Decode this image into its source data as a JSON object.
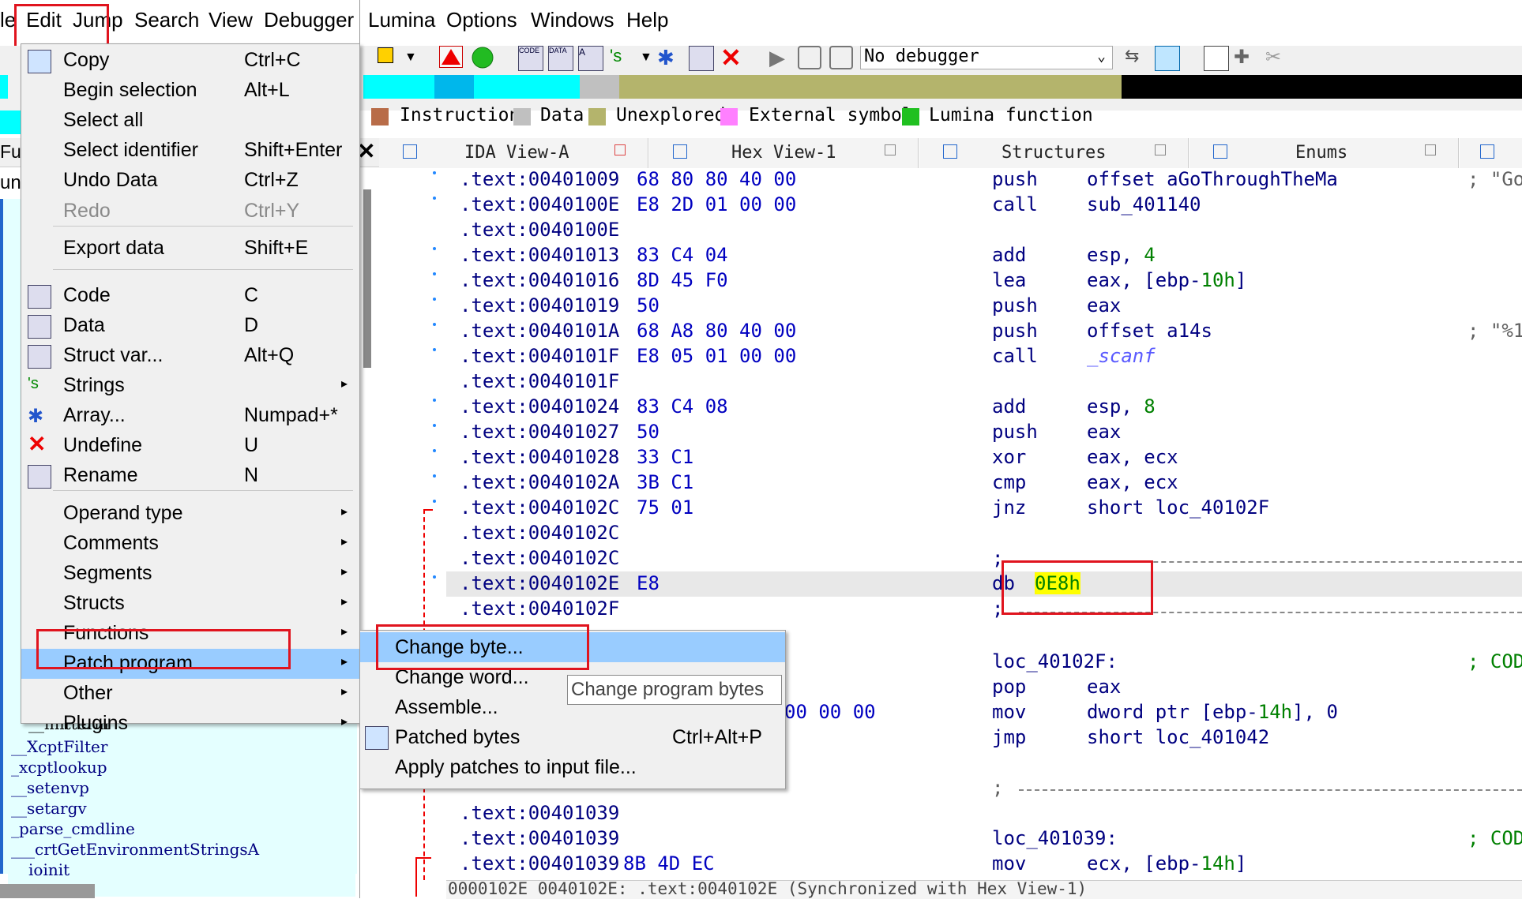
{
  "menubar": {
    "items": [
      "le",
      "Edit",
      "Jump",
      "Search",
      "View",
      "Debugger",
      "Lumina",
      "Options",
      "Windows",
      "Help"
    ]
  },
  "toolbar": {
    "debugger_select": "No debugger"
  },
  "legend": [
    {
      "label": "Instruction",
      "color": "#b86c48"
    },
    {
      "label": "Data",
      "color": "#c0c0c0"
    },
    {
      "label": "Unexplored",
      "color": "#b4b46c"
    },
    {
      "label": "External symbol",
      "color": "#ff80ff"
    },
    {
      "label": "Lumina function",
      "color": "#20c020"
    }
  ],
  "left_panel": {
    "header": "Fu",
    "header2": "un",
    "functions": [
      "__initterm",
      "__XcptFilter",
      "_xcptlookup",
      "__setenvp",
      "__setargv",
      "_parse_cmdline",
      "___crtGetEnvironmentStringsA",
      "ioinit"
    ]
  },
  "tabs": [
    {
      "label": "IDA View-A"
    },
    {
      "label": "Hex View-1"
    },
    {
      "label": "Structures"
    },
    {
      "label": "Enums"
    }
  ],
  "listing": [
    {
      "addr": ".text:00401009",
      "bytes": "68 80 80 40 00",
      "mnem": "push",
      "op": "offset aGoThroughTheMa",
      "cm": "; \"Go"
    },
    {
      "addr": ".text:0040100E",
      "bytes": "E8 2D 01 00 00",
      "mnem": "call",
      "op": "sub_401140",
      "cm": ""
    },
    {
      "addr": ".text:0040100E",
      "bytes": "",
      "mnem": "",
      "op": "",
      "cm": ""
    },
    {
      "addr": ".text:00401013",
      "bytes": "83 C4 04",
      "mnem": "add",
      "op": "esp, ",
      "num": "4",
      "cm": ""
    },
    {
      "addr": ".text:00401016",
      "bytes": "8D 45 F0",
      "mnem": "lea",
      "op": "eax, [ebp-",
      "num": "10h",
      "op2": "]",
      "cm": ""
    },
    {
      "addr": ".text:00401019",
      "bytes": "50",
      "mnem": "push",
      "op": "eax",
      "cm": ""
    },
    {
      "addr": ".text:0040101A",
      "bytes": "68 A8 80 40 00",
      "mnem": "push",
      "op": "offset a14s",
      "cm": "; \"%1"
    },
    {
      "addr": ".text:0040101F",
      "bytes": "E8 05 01 00 00",
      "mnem": "call",
      "op": "",
      "lib": "_scanf",
      "cm": ""
    },
    {
      "addr": ".text:0040101F",
      "bytes": "",
      "mnem": "",
      "op": "",
      "cm": ""
    },
    {
      "addr": ".text:00401024",
      "bytes": "83 C4 08",
      "mnem": "add",
      "op": "esp, ",
      "num": "8",
      "cm": ""
    },
    {
      "addr": ".text:00401027",
      "bytes": "50",
      "mnem": "push",
      "op": "eax",
      "cm": ""
    },
    {
      "addr": ".text:00401028",
      "bytes": "33 C1",
      "mnem": "xor",
      "op": "eax, ecx",
      "cm": ""
    },
    {
      "addr": ".text:0040102A",
      "bytes": "3B C1",
      "mnem": "cmp",
      "op": "eax, ecx",
      "cm": ""
    },
    {
      "addr": ".text:0040102C",
      "bytes": "75 01",
      "mnem": "jnz",
      "op": "short loc_40102F",
      "cm": ""
    },
    {
      "addr": ".text:0040102C",
      "bytes": "",
      "mnem": "",
      "op": "",
      "cm": ""
    },
    {
      "addr": ".text:0040102C",
      "bytes": "",
      "mnem": ";",
      "op": "",
      "cm": ""
    },
    {
      "addr": ".text:0040102E",
      "bytes": "E8",
      "mnem": "db",
      "op": "",
      "hl": "0E8h",
      "cm": ""
    },
    {
      "addr": ".text:0040102F",
      "bytes": "",
      "mnem": ";",
      "op": "",
      "cm": ""
    }
  ],
  "lower_listing": {
    "loc1": "loc_40102F:",
    "cod1": "; COD",
    "pop": {
      "mnem": "pop",
      "op": "eax"
    },
    "mov": {
      "bytes": "00 00 00",
      "mnem": "mov",
      "op": "dword ptr [ebp-",
      "num": "14h",
      "op2": "], 0"
    },
    "jmp": {
      "mnem": "jmp",
      "op": "short loc_401042"
    },
    "semi": ";",
    "a1": ".text:00401039",
    "a2": ".text:00401039",
    "a3": ".text:00401039",
    "loc2": "loc_401039:",
    "cod2": "; COD",
    "last": {
      "addr": ".text:00401039",
      "bytes": "8B 4D EC",
      "mnem": "mov",
      "op": "ecx, [ebp-",
      "num": "14h",
      "op2": "]"
    }
  },
  "status": "0000102E 0040102E: .text:0040102E (Synchronized with Hex View-1)",
  "edit_menu": {
    "items": [
      {
        "label": "Copy",
        "shortcut": "Ctrl+C"
      },
      {
        "label": "Begin selection",
        "shortcut": "Alt+L"
      },
      {
        "label": "Select all",
        "shortcut": ""
      },
      {
        "label": "Select identifier",
        "shortcut": "Shift+Enter"
      },
      {
        "label": "Undo Data",
        "shortcut": "Ctrl+Z"
      },
      {
        "label": "Redo",
        "shortcut": "Ctrl+Y"
      },
      {
        "label": "Export data",
        "shortcut": "Shift+E"
      },
      {
        "label": "Code",
        "shortcut": "C"
      },
      {
        "label": "Data",
        "shortcut": "D"
      },
      {
        "label": "Struct var...",
        "shortcut": "Alt+Q"
      },
      {
        "label": "Strings",
        "shortcut": ""
      },
      {
        "label": "Array...",
        "shortcut": "Numpad+*"
      },
      {
        "label": "Undefine",
        "shortcut": "U"
      },
      {
        "label": "Rename",
        "shortcut": "N"
      },
      {
        "label": "Operand type",
        "shortcut": ""
      },
      {
        "label": "Comments",
        "shortcut": ""
      },
      {
        "label": "Segments",
        "shortcut": ""
      },
      {
        "label": "Structs",
        "shortcut": ""
      },
      {
        "label": "Functions",
        "shortcut": ""
      },
      {
        "label": "Patch program",
        "shortcut": ""
      },
      {
        "label": "Other",
        "shortcut": ""
      },
      {
        "label": "Plugins",
        "shortcut": ""
      }
    ]
  },
  "patch_submenu": {
    "items": [
      {
        "label": "Change byte...",
        "shortcut": ""
      },
      {
        "label": "Change word...",
        "shortcut": ""
      },
      {
        "label": "Assemble...",
        "shortcut": ""
      },
      {
        "label": "Patched bytes",
        "shortcut": "Ctrl+Alt+P"
      },
      {
        "label": "Apply patches to input file...",
        "shortcut": ""
      }
    ],
    "tooltip": "Change program bytes"
  }
}
